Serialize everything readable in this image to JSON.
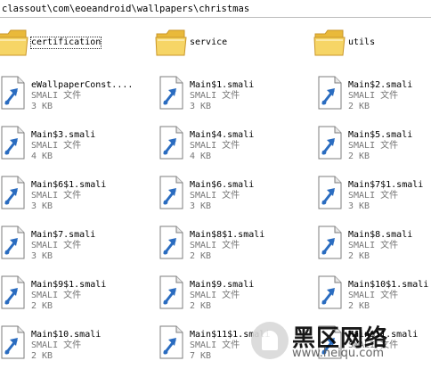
{
  "address_bar": {
    "path": "classout\\com\\eoeandroid\\wallpapers\\christmas"
  },
  "items": [
    {
      "type": "folder",
      "name": "certification",
      "selected": true
    },
    {
      "type": "folder",
      "name": "service"
    },
    {
      "type": "folder",
      "name": "utils"
    },
    {
      "type": "file",
      "name": "eWallpaperConst....",
      "kind": "SMALI 文件",
      "size": "3 KB"
    },
    {
      "type": "file",
      "name": "Main$1.smali",
      "kind": "SMALI 文件",
      "size": "3 KB"
    },
    {
      "type": "file",
      "name": "Main$2.smali",
      "kind": "SMALI 文件",
      "size": "2 KB"
    },
    {
      "type": "file",
      "name": "Main$3.smali",
      "kind": "SMALI 文件",
      "size": "4 KB"
    },
    {
      "type": "file",
      "name": "Main$4.smali",
      "kind": "SMALI 文件",
      "size": "4 KB"
    },
    {
      "type": "file",
      "name": "Main$5.smali",
      "kind": "SMALI 文件",
      "size": "2 KB"
    },
    {
      "type": "file",
      "name": "Main$6$1.smali",
      "kind": "SMALI 文件",
      "size": "3 KB"
    },
    {
      "type": "file",
      "name": "Main$6.smali",
      "kind": "SMALI 文件",
      "size": "3 KB"
    },
    {
      "type": "file",
      "name": "Main$7$1.smali",
      "kind": "SMALI 文件",
      "size": "3 KB"
    },
    {
      "type": "file",
      "name": "Main$7.smali",
      "kind": "SMALI 文件",
      "size": "3 KB"
    },
    {
      "type": "file",
      "name": "Main$8$1.smali",
      "kind": "SMALI 文件",
      "size": "2 KB"
    },
    {
      "type": "file",
      "name": "Main$8.smali",
      "kind": "SMALI 文件",
      "size": "2 KB"
    },
    {
      "type": "file",
      "name": "Main$9$1.smali",
      "kind": "SMALI 文件",
      "size": "2 KB"
    },
    {
      "type": "file",
      "name": "Main$9.smali",
      "kind": "SMALI 文件",
      "size": "2 KB"
    },
    {
      "type": "file",
      "name": "Main$10$1.smali",
      "kind": "SMALI 文件",
      "size": "2 KB"
    },
    {
      "type": "file",
      "name": "Main$10.smali",
      "kind": "SMALI 文件",
      "size": "2 KB"
    },
    {
      "type": "file",
      "name": "Main$11$1.smali",
      "kind": "SMALI 文件",
      "size": "7 KB"
    },
    {
      "type": "file",
      "name": "Main$11.smali",
      "kind": "SMALI 文件",
      "size": ""
    }
  ],
  "watermark": {
    "logo_text": "黑区网络",
    "url": "www.heiqu.com"
  },
  "colors": {
    "folder": "#f6d566",
    "file_arrow": "#2a6cc0",
    "selection_outline": "#333333"
  }
}
